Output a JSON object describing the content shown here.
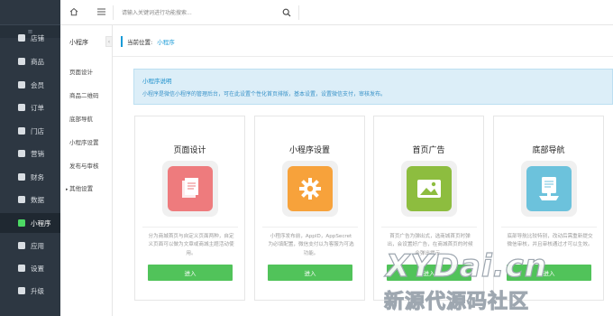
{
  "nav": {
    "collapse_glyph": "≡",
    "items": [
      {
        "label": "店铺",
        "icon": "store-icon"
      },
      {
        "label": "商品",
        "icon": "goods-icon"
      },
      {
        "label": "会员",
        "icon": "member-icon"
      },
      {
        "label": "订单",
        "icon": "order-icon"
      },
      {
        "label": "门店",
        "icon": "shop-icon"
      },
      {
        "label": "营销",
        "icon": "marketing-icon"
      },
      {
        "label": "财务",
        "icon": "finance-icon"
      },
      {
        "label": "数据",
        "icon": "data-icon"
      },
      {
        "label": "小程序",
        "icon": "miniprogram-icon"
      },
      {
        "label": "应用",
        "icon": "apps-icon"
      },
      {
        "label": "设置",
        "icon": "settings-icon"
      },
      {
        "label": "升级",
        "icon": "upgrade-icon"
      }
    ],
    "active_index": 8
  },
  "subnav": {
    "title": "小程序",
    "items": [
      "页面设计",
      "商品二维码",
      "底部导航",
      "小程序设置",
      "发布与审核",
      "其他设置"
    ],
    "collapse_glyph": "‹"
  },
  "topbar": {
    "search_placeholder": "请输入关键词进行功能搜索..."
  },
  "breadcrumb": {
    "label": "当前位置:",
    "current": "小程序"
  },
  "info": {
    "title": "小程序说明",
    "text": "小程序是微信小程序的管理后台，可在此设置个性化首页排版，基本设置，设置微信支付，审核发布。"
  },
  "cards": [
    {
      "title": "页面设计",
      "icon": "page-design-icon",
      "color": "#ee7b7d",
      "desc": "分为商城首页与自定义页面两种，自定义页面可以做为文章或商城主题活动使用。",
      "button": "进入"
    },
    {
      "title": "小程序设置",
      "icon": "settings-gear-icon",
      "color": "#f7a23b",
      "desc": "小程序发布前，AppID，AppSecret为必填配置，微信支付以为客服为可选功能。",
      "button": "进入"
    },
    {
      "title": "首页广告",
      "icon": "ad-image-icon",
      "color": "#8dbd3f",
      "desc": "首页广告为弹出式，选商城首页时弹出，会设置好广告，在商城首页的时候会弹出提示。",
      "button": "进入"
    },
    {
      "title": "底部导航",
      "icon": "bottom-nav-icon",
      "color": "#6cc2dc",
      "desc": "底部导航比较特别，改动后需重新提交微信审核，并且审核通过才可以生效。",
      "button": "进入"
    }
  ],
  "watermark": {
    "line1": "XYDai.cn",
    "line2": "新源代源码社区"
  }
}
